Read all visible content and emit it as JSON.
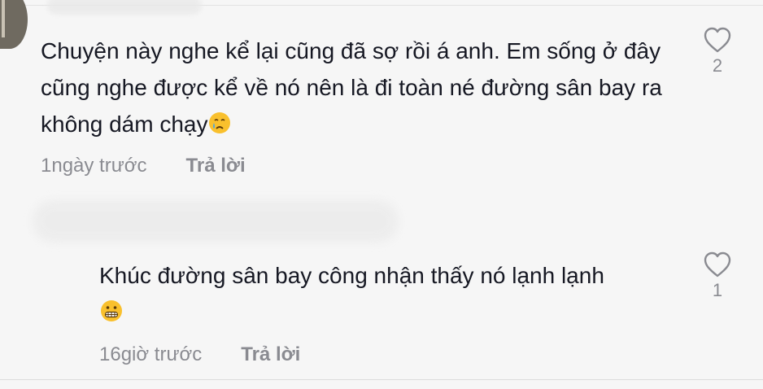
{
  "comments": [
    {
      "text": "Chuyện này nghe kể lại cũng đã sợ rồi á anh. Em sống ở đây cũng nghe được kể về nó nên là đi toàn né đường sân bay ra không dám chạy",
      "emoji": "crying-face",
      "time": "1ngày trước",
      "reply_label": "Trả lời",
      "likes": "2"
    },
    {
      "text": "Khúc đường sân bay công nhận thấy nó lạnh lạnh",
      "emoji": "grimacing-face",
      "time": "16giờ trước",
      "reply_label": "Trả lời",
      "likes": "1"
    }
  ]
}
